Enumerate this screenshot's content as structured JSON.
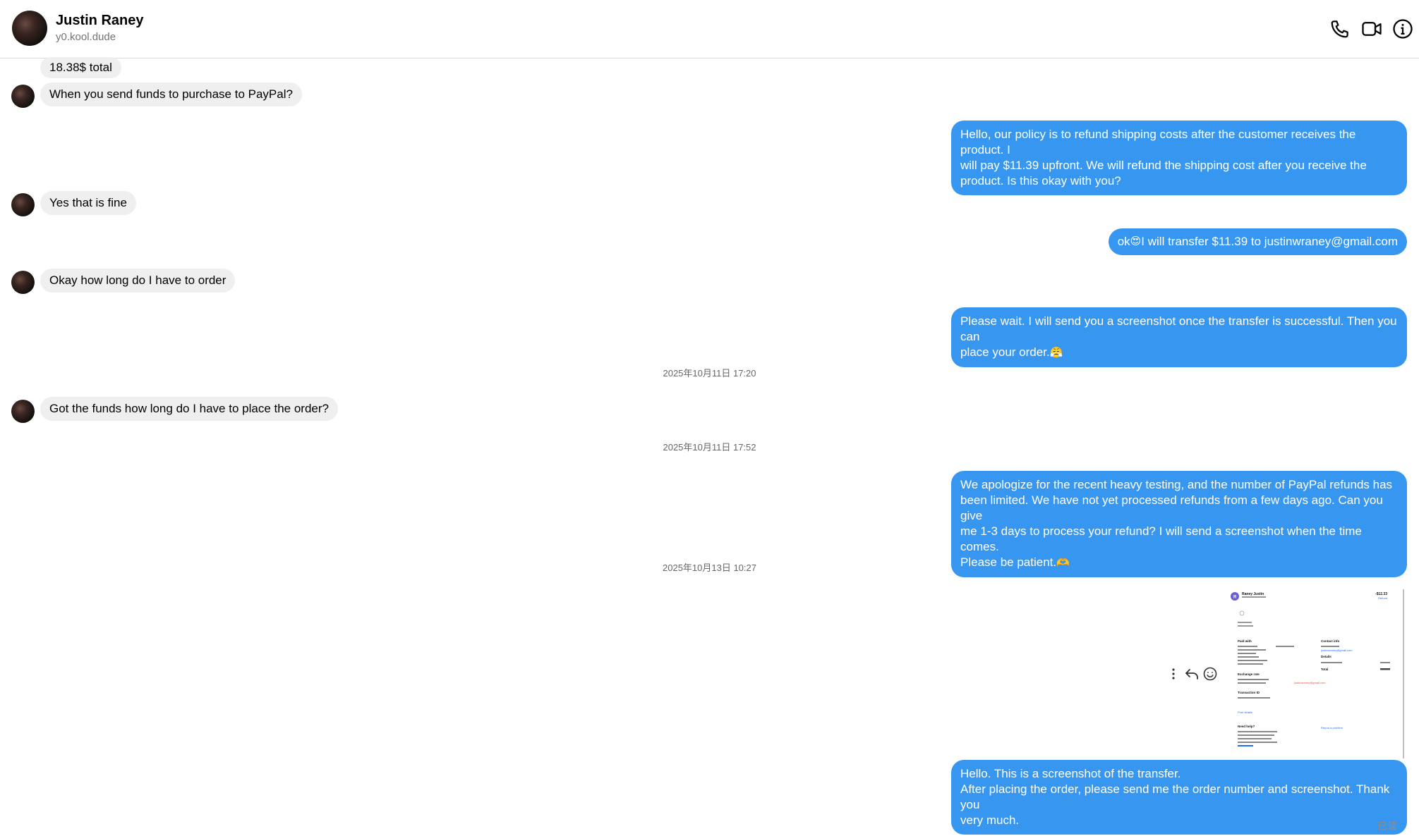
{
  "header": {
    "name": "Justin Raney",
    "username": "y0.kool.dude",
    "icons": [
      "phone-icon",
      "video-icon",
      "info-icon"
    ]
  },
  "colors": {
    "outgoing_bubble": "#3797f0",
    "incoming_bubble": "#efefef",
    "timestamp": "#65676b"
  },
  "messages": {
    "m1": "18.38$ total",
    "m2": "When you send funds to purchase to PayPal?",
    "m3": {
      "l1": "Hello, our policy is to refund shipping costs after the customer receives the product. I",
      "l2": "will pay $11.39 upfront. We will refund the shipping cost after you receive the",
      "l3": "product. Is this okay with you?"
    },
    "m4": "Yes that is fine",
    "m5": {
      "pre": "ok",
      "emoji": "😍",
      "post": " I will transfer $11.39 to justinwraney@gmail.com"
    },
    "m6": "Okay how long do I have to order",
    "m7": {
      "l1": "Please wait. I will send you a screenshot once the transfer is successful. Then you can",
      "l2": "place your order.",
      "emoji": "😤"
    },
    "ts1": "2025年10月11日 17:20",
    "m8": "Got the funds how long do I have to place the order?",
    "ts2": "2025年10月11日 17:52",
    "m9": {
      "l1": "We apologize for the recent heavy testing, and the number of PayPal refunds has",
      "l2": "been limited. We have not yet processed refunds from a few days ago. Can you give",
      "l3": "me 1-3 days to process your refund? I will send a screenshot when the time comes.",
      "l4": "Please be patient.",
      "emoji": "🫶"
    },
    "ts3": "2025年10月13日 10:27",
    "m10": {
      "l1": "Hello. This is a screenshot of the transfer.",
      "l2": "After placing the order, please send me the order number and screenshot. Thank you",
      "l3": "very much."
    },
    "read_receipt": "已读"
  },
  "attachment": {
    "name": "Raney Justin",
    "amount": "-$12.33",
    "status": "Refund",
    "paid_with": "Paid with",
    "contact_info": "Contact info",
    "contact_email": "justinwraney@gmail.com",
    "email_annotation": "justinwraney@gmail.com",
    "details": "Details",
    "total": "Total",
    "exchange_rate": "Exchange rate",
    "transaction_id": "Transaction ID",
    "print_details": "Print details",
    "need_help": "Need help?",
    "report_problem": "Report a problem"
  },
  "hover_actions": [
    "more-options-icon",
    "reply-icon",
    "react-icon"
  ]
}
